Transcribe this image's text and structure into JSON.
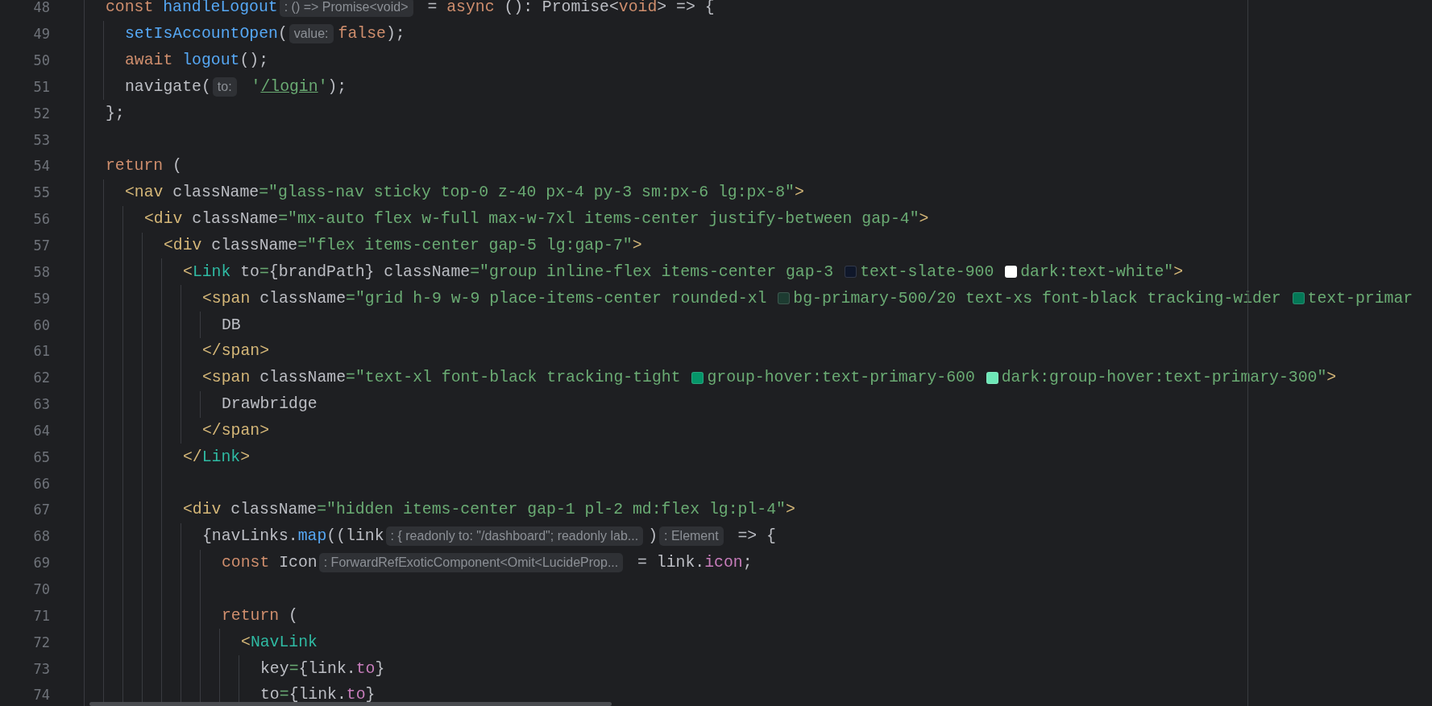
{
  "editor": {
    "lines": [
      {
        "number": "48",
        "tokens": [
          {
            "kind": "kw",
            "text": "    const "
          },
          {
            "kind": "fn",
            "text": "handleLogout"
          },
          {
            "kind": "hint",
            "text": ": () => Promise<void>"
          },
          {
            "kind": "txt",
            "text": " = "
          },
          {
            "kind": "kw",
            "text": "async"
          },
          {
            "kind": "txt",
            "text": " (): Promise<"
          },
          {
            "kind": "kw",
            "text": "void"
          },
          {
            "kind": "txt",
            "text": "> => {"
          }
        ]
      },
      {
        "number": "49",
        "tokens": [
          {
            "kind": "fn",
            "text": "      setIsAccountOpen"
          },
          {
            "kind": "txt",
            "text": "("
          },
          {
            "kind": "hint",
            "text": "value:"
          },
          {
            "kind": "kw",
            "text": "false"
          },
          {
            "kind": "txt",
            "text": ");"
          }
        ]
      },
      {
        "number": "50",
        "tokens": [
          {
            "kind": "kw",
            "text": "      await "
          },
          {
            "kind": "fn",
            "text": "logout"
          },
          {
            "kind": "txt",
            "text": "();"
          }
        ]
      },
      {
        "number": "51",
        "tokens": [
          {
            "kind": "txt",
            "text": "      navigate("
          },
          {
            "kind": "hint",
            "text": "to:"
          },
          {
            "kind": "str",
            "text": " '"
          },
          {
            "kind": "url",
            "text": "/login"
          },
          {
            "kind": "str",
            "text": "'"
          },
          {
            "kind": "txt",
            "text": ");"
          }
        ]
      },
      {
        "number": "52",
        "tokens": [
          {
            "kind": "txt",
            "text": "    };"
          }
        ]
      },
      {
        "number": "53"
      },
      {
        "number": "54",
        "tokens": [
          {
            "kind": "kw",
            "text": "    return"
          },
          {
            "kind": "txt",
            "text": " ("
          }
        ]
      },
      {
        "number": "55",
        "tokens": [
          {
            "kind": "tag",
            "text": "      <nav"
          },
          {
            "kind": "txt",
            "text": " className"
          },
          {
            "kind": "str",
            "text": "=\"glass-nav sticky top-0 z-40 px-4 py-3 sm:px-6 lg:px-8\""
          },
          {
            "kind": "tag",
            "text": ">"
          }
        ]
      },
      {
        "number": "56",
        "tokens": [
          {
            "kind": "tag",
            "text": "        <div"
          },
          {
            "kind": "txt",
            "text": " className"
          },
          {
            "kind": "str",
            "text": "=\"mx-auto flex w-full max-w-7xl items-center justify-between gap-4\""
          },
          {
            "kind": "tag",
            "text": ">"
          }
        ]
      },
      {
        "number": "57",
        "tokens": [
          {
            "kind": "tag",
            "text": "          <div"
          },
          {
            "kind": "txt",
            "text": " className"
          },
          {
            "kind": "str",
            "text": "=\"flex items-center gap-5 lg:gap-7\""
          },
          {
            "kind": "tag",
            "text": ">"
          }
        ]
      },
      {
        "number": "58",
        "tokens": [
          {
            "kind": "tag",
            "text": "            <"
          },
          {
            "kind": "comp",
            "text": "Link"
          },
          {
            "kind": "txt",
            "text": " to"
          },
          {
            "kind": "str",
            "text": "="
          },
          {
            "kind": "txt",
            "text": "{brandPath} className"
          },
          {
            "kind": "str",
            "text": "=\"group inline-flex items-center gap-3 "
          },
          {
            "kind": "swatch",
            "color": "#0f172a"
          },
          {
            "kind": "str",
            "text": "text-slate-900 "
          },
          {
            "kind": "swatch",
            "color": "#ffffff"
          },
          {
            "kind": "str",
            "text": "dark:text-white\""
          },
          {
            "kind": "tag",
            "text": ">"
          }
        ]
      },
      {
        "number": "59",
        "tokens": [
          {
            "kind": "tag",
            "text": "              <span"
          },
          {
            "kind": "txt",
            "text": " className"
          },
          {
            "kind": "str",
            "text": "=\"grid h-9 w-9 place-items-center rounded-xl "
          },
          {
            "kind": "swatch",
            "color": "#1d3b31"
          },
          {
            "kind": "str",
            "text": "bg-primary-500/20 text-xs font-black tracking-wider "
          },
          {
            "kind": "swatch",
            "color": "#047857"
          },
          {
            "kind": "str",
            "text": "text-primar"
          }
        ]
      },
      {
        "number": "60",
        "tokens": [
          {
            "kind": "txt",
            "text": "                DB"
          }
        ]
      },
      {
        "number": "61",
        "tokens": [
          {
            "kind": "tag",
            "text": "              </span>"
          }
        ]
      },
      {
        "number": "62",
        "tokens": [
          {
            "kind": "tag",
            "text": "              <span"
          },
          {
            "kind": "txt",
            "text": " className"
          },
          {
            "kind": "str",
            "text": "=\"text-xl font-black tracking-tight "
          },
          {
            "kind": "swatch",
            "color": "#059669"
          },
          {
            "kind": "str",
            "text": "group-hover:text-primary-600 "
          },
          {
            "kind": "swatch",
            "color": "#6ee7b7"
          },
          {
            "kind": "str",
            "text": "dark:group-hover:text-primary-300\""
          },
          {
            "kind": "tag",
            "text": ">"
          }
        ]
      },
      {
        "number": "63",
        "tokens": [
          {
            "kind": "txt",
            "text": "                Drawbridge"
          }
        ]
      },
      {
        "number": "64",
        "tokens": [
          {
            "kind": "tag",
            "text": "              </span>"
          }
        ]
      },
      {
        "number": "65",
        "tokens": [
          {
            "kind": "tag",
            "text": "            </"
          },
          {
            "kind": "comp",
            "text": "Link"
          },
          {
            "kind": "tag",
            "text": ">"
          }
        ]
      },
      {
        "number": "66"
      },
      {
        "number": "67",
        "tokens": [
          {
            "kind": "tag",
            "text": "            <div"
          },
          {
            "kind": "txt",
            "text": " className"
          },
          {
            "kind": "str",
            "text": "=\"hidden items-center gap-1 pl-2 md:flex lg:pl-4\""
          },
          {
            "kind": "tag",
            "text": ">"
          }
        ]
      },
      {
        "number": "68",
        "tokens": [
          {
            "kind": "txt",
            "text": "              {navLinks."
          },
          {
            "kind": "fn",
            "text": "map"
          },
          {
            "kind": "txt",
            "text": "((link"
          },
          {
            "kind": "hint",
            "text": ": { readonly to: \"/dashboard\"; readonly lab..."
          },
          {
            "kind": "txt",
            "text": ")"
          },
          {
            "kind": "hint",
            "text": ": Element"
          },
          {
            "kind": "txt",
            "text": " => {"
          }
        ]
      },
      {
        "number": "69",
        "tokens": [
          {
            "kind": "kw",
            "text": "                const "
          },
          {
            "kind": "txt",
            "text": "Icon"
          },
          {
            "kind": "hint",
            "text": ": ForwardRefExoticComponent<Omit<LucideProp..."
          },
          {
            "kind": "txt",
            "text": " = link."
          },
          {
            "kind": "prop",
            "text": "icon"
          },
          {
            "kind": "txt",
            "text": ";"
          }
        ]
      },
      {
        "number": "70"
      },
      {
        "number": "71",
        "tokens": [
          {
            "kind": "kw",
            "text": "                return"
          },
          {
            "kind": "txt",
            "text": " ("
          }
        ]
      },
      {
        "number": "72",
        "tokens": [
          {
            "kind": "tag",
            "text": "                  <"
          },
          {
            "kind": "comp",
            "text": "NavLink"
          }
        ]
      },
      {
        "number": "73",
        "tokens": [
          {
            "kind": "txt",
            "text": "                    key"
          },
          {
            "kind": "str",
            "text": "="
          },
          {
            "kind": "txt",
            "text": "{link."
          },
          {
            "kind": "prop",
            "text": "to"
          },
          {
            "kind": "txt",
            "text": "}"
          }
        ]
      },
      {
        "number": "74",
        "tokens": [
          {
            "kind": "txt",
            "text": "                    to"
          },
          {
            "kind": "str",
            "text": "="
          },
          {
            "kind": "txt",
            "text": "{link."
          },
          {
            "kind": "prop",
            "text": "to"
          },
          {
            "kind": "txt",
            "text": "}"
          }
        ]
      }
    ]
  }
}
